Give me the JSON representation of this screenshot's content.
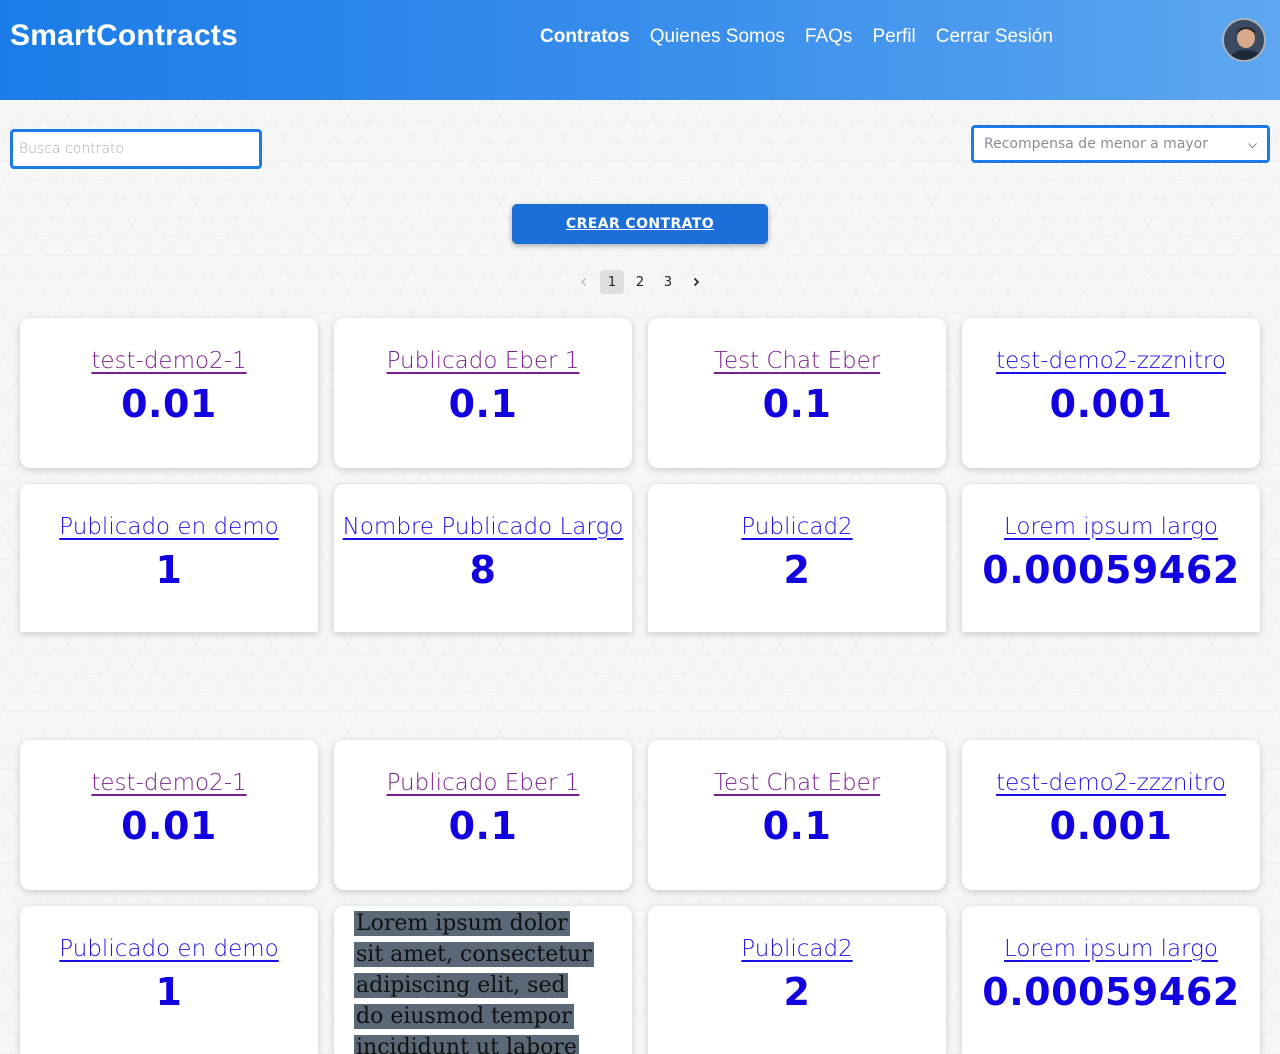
{
  "header": {
    "brand": "SmartContracts",
    "nav": [
      "Contratos",
      "Quienes Somos",
      "FAQs",
      "Perfil",
      "Cerrar Sesión"
    ],
    "active_nav": "Contratos"
  },
  "controls": {
    "search_placeholder": "Busca contrato",
    "sort_selected": "Recompensa de menor a mayor",
    "create_label": "CREAR CONTRATO"
  },
  "pagination": {
    "prev_icon": "chevron-left-icon",
    "next_icon": "chevron-right-icon",
    "pages": [
      "1",
      "2",
      "3"
    ],
    "current": "1"
  },
  "cards_block_1": [
    {
      "title": "test-demo2-1",
      "value": "0.01"
    },
    {
      "title": "Publicado Eber 1",
      "value": "0.1"
    },
    {
      "title": "Test Chat Eber",
      "value": "0.1"
    },
    {
      "title": "test-demo2-zzznitro",
      "value": "0.001"
    },
    {
      "title": "Publicado en demo",
      "value": "1"
    },
    {
      "title": "Nombre Publicado Largo",
      "value": "8"
    },
    {
      "title": "Publicad2",
      "value": "2"
    },
    {
      "title": "Lorem ipsum largo",
      "value": "0.00059462"
    }
  ],
  "cards_block_2": [
    {
      "title": "test-demo2-1",
      "value": "0.01"
    },
    {
      "title": "Publicado Eber 1",
      "value": "0.1"
    },
    {
      "title": "Test Chat Eber",
      "value": "0.1"
    },
    {
      "title": "test-demo2-zzznitro",
      "value": "0.001"
    },
    {
      "title": "Publicado en demo",
      "value": "1"
    },
    {
      "title": "",
      "value": ""
    },
    {
      "title": "Publicad2",
      "value": "2"
    },
    {
      "title": "Lorem ipsum largo",
      "value": "0.00059462"
    }
  ],
  "overlay_text": "Lorem ipsum dolor sit amet, consectetur adipiscing elit, sed do eiusmod tempor incididunt ut labore et",
  "colors": {
    "header_start": "#1b7ce8",
    "header_end": "#5ea6f0",
    "accent": "#1d6fd8",
    "value_blue": "#1200e0",
    "visited_link": "#7a1f8f",
    "link": "#1c10e8"
  }
}
